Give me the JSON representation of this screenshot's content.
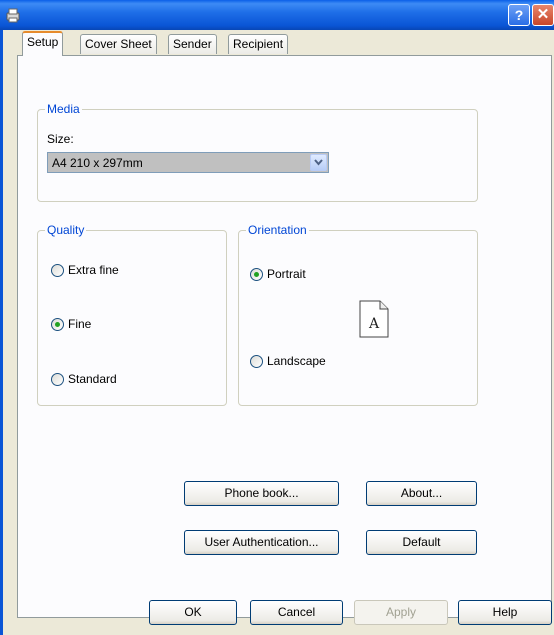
{
  "window": {
    "help_glyph": "?",
    "close_glyph": "✕",
    "title_color": "#0a55d6"
  },
  "tabs": [
    {
      "label": "Setup",
      "active": true
    },
    {
      "label": "Cover Sheet",
      "active": false
    },
    {
      "label": "Sender",
      "active": false
    },
    {
      "label": "Recipient",
      "active": false
    }
  ],
  "media": {
    "legend": "Media",
    "size_label": "Size:",
    "size_value": "A4 210 x 297mm"
  },
  "quality": {
    "legend": "Quality",
    "options": [
      {
        "label": "Extra fine",
        "checked": false
      },
      {
        "label": "Fine",
        "checked": true
      },
      {
        "label": "Standard",
        "checked": false
      }
    ]
  },
  "orientation": {
    "legend": "Orientation",
    "options": [
      {
        "label": "Portrait",
        "checked": true
      },
      {
        "label": "Landscape",
        "checked": false
      }
    ],
    "preview_letter": "A"
  },
  "panel_buttons": {
    "phone_book": "Phone book...",
    "about": "About...",
    "user_auth": "User Authentication...",
    "default": "Default"
  },
  "footer_buttons": {
    "ok": "OK",
    "cancel": "Cancel",
    "apply": "Apply",
    "help": "Help",
    "apply_disabled": true
  }
}
